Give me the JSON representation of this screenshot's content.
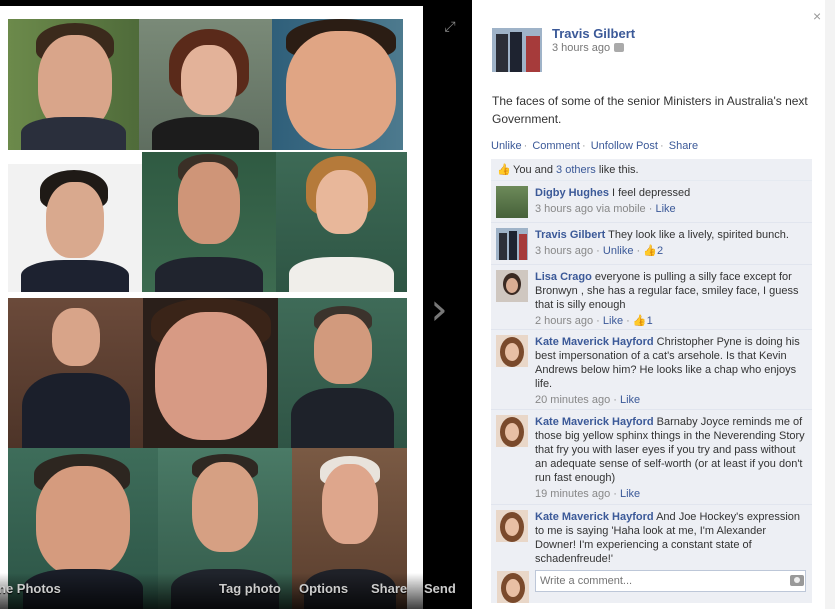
{
  "photo": {
    "expand_icon": "expand-icon",
    "next_icon": "chevron-right-icon",
    "next_glyph": "›",
    "expand_glyph": "⤢"
  },
  "toolbar": {
    "photos_label": "ne Photos",
    "tag_label": "Tag photo",
    "options_label": "Options",
    "share_label": "Share",
    "send_label": "Send"
  },
  "post": {
    "close_glyph": "×",
    "owner_name": "Travis Gilbert",
    "time": "3 hours ago",
    "caption": "The faces of some of the senior Ministers in Australia's next Government.",
    "actions": [
      "Unlike",
      "Comment",
      "Unfollow Post",
      "Share"
    ],
    "likes_prefix": "You and ",
    "likes_link": "3 others",
    "likes_suffix": " like this."
  },
  "comments": [
    {
      "name": "Digby Hughes",
      "text": "I feel depressed",
      "time": "3 hours ago via mobile",
      "action": "Like",
      "like_count": ""
    },
    {
      "name": "Travis Gilbert",
      "text": "They look like a lively, spirited bunch.",
      "time": "3 hours ago",
      "action": "Unlike",
      "like_count": "2"
    },
    {
      "name": "Lisa Crago",
      "text": "everyone is pulling a silly face except for Bronwyn , she has a regular face, smiley face, I guess that is silly enough",
      "time": "2 hours ago",
      "action": "Like",
      "like_count": "1"
    },
    {
      "name": "Kate Maverick Hayford",
      "text": "Christopher Pyne is doing his best impersonation of a cat's arsehole. Is that Kevin Andrews below him? He looks like a chap who enjoys life.",
      "time": "20 minutes ago",
      "action": "Like",
      "like_count": ""
    },
    {
      "name": "Kate Maverick Hayford",
      "text": "Barnaby Joyce reminds me of those big yellow sphinx things in the Neverending Story that fry you with laser eyes if you try and pass without an adequate sense of self-worth (or at least if you don't run fast enough)",
      "time": "19 minutes ago",
      "action": "Like",
      "like_count": ""
    },
    {
      "name": "Kate Maverick Hayford",
      "text": "And Joe Hockey's expression to me is saying 'Haha look at me, I'm Alexander Downer! I'm experiencing a constant state of schadenfreude!'",
      "time": "",
      "action": "",
      "like_count": ""
    }
  ],
  "composer": {
    "placeholder": "Write a comment..."
  },
  "colors": {
    "link": "#3b5998",
    "panel": "#edeff4",
    "stage": "#000000"
  }
}
